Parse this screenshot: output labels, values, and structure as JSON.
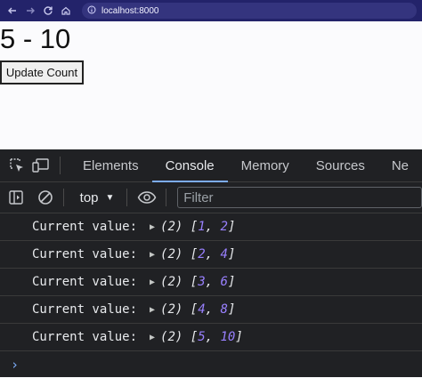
{
  "browser": {
    "url": "localhost:8000",
    "icons": [
      "back-arrow-icon",
      "forward-arrow-icon",
      "reload-icon",
      "home-icon",
      "site-info-icon"
    ]
  },
  "page": {
    "heading": "5 - 10",
    "button_label": "Update Count"
  },
  "devtools": {
    "tabs": [
      "Elements",
      "Console",
      "Memory",
      "Sources",
      "Ne"
    ],
    "active_tab": "Console",
    "context": "top",
    "filter_placeholder": "Filter",
    "accent": "#7cacf8",
    "number_color": "#9980ff",
    "console_lines": [
      {
        "label": "Current value:",
        "count": "(2)",
        "values": [
          "1",
          "2"
        ]
      },
      {
        "label": "Current value:",
        "count": "(2)",
        "values": [
          "2",
          "4"
        ]
      },
      {
        "label": "Current value:",
        "count": "(2)",
        "values": [
          "3",
          "6"
        ]
      },
      {
        "label": "Current value:",
        "count": "(2)",
        "values": [
          "4",
          "8"
        ]
      },
      {
        "label": "Current value:",
        "count": "(2)",
        "values": [
          "5",
          "10"
        ]
      }
    ]
  }
}
